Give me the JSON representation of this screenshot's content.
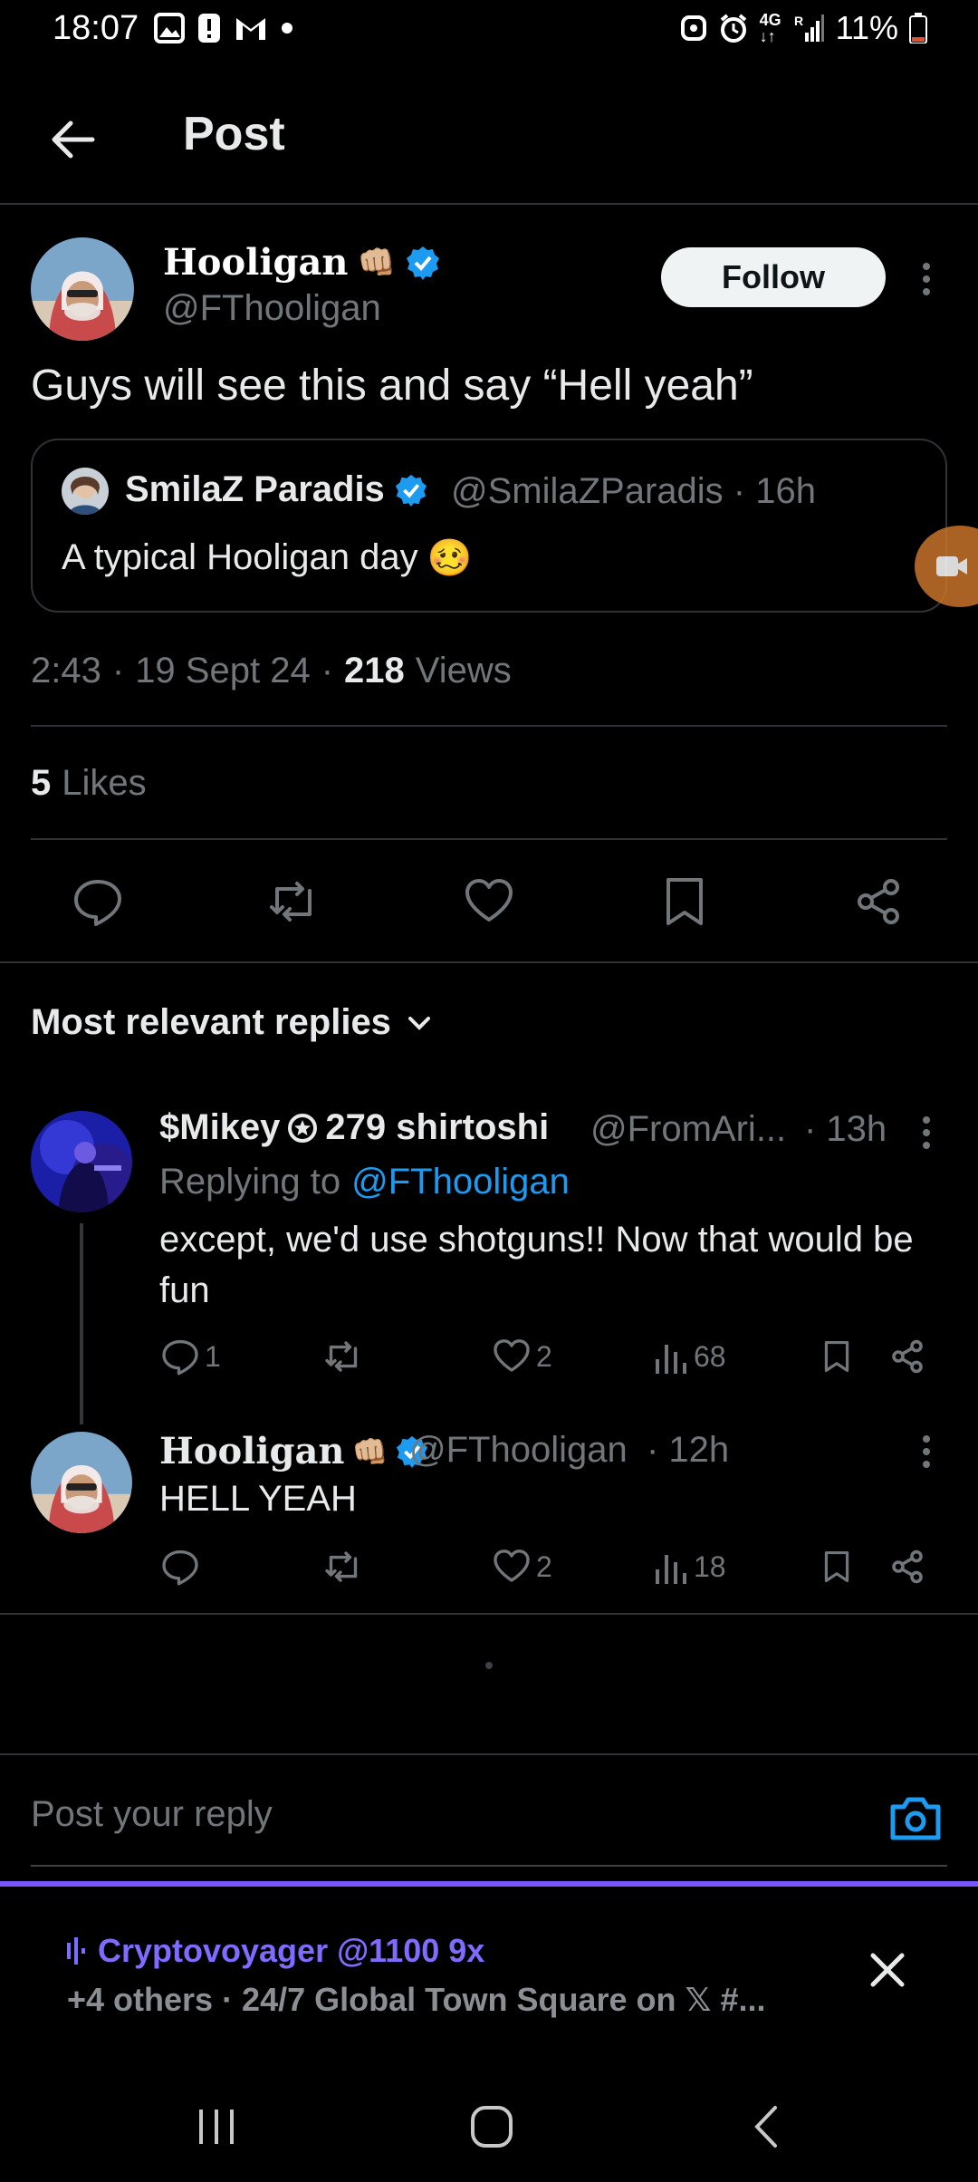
{
  "status_bar": {
    "time": "18:07",
    "network": "4G",
    "signal_label": "R",
    "battery": "11%"
  },
  "header": {
    "title": "Post"
  },
  "post": {
    "author_name": "Hooligan",
    "author_emoji": "👊🏼",
    "author_handle": "@FThooligan",
    "follow_label": "Follow",
    "text": "Guys will see this and say “Hell yeah”",
    "quote": {
      "name": "SmilaZ Paradis",
      "handle_time": "@SmilaZParadis · 16h",
      "text": "A typical Hooligan day",
      "emoji": "🥴"
    },
    "time": "2:43",
    "date": "19 Sept 24",
    "views_count": "218",
    "views_label": "Views",
    "likes_count": "5",
    "likes_label": "Likes"
  },
  "replies_sort_label": "Most relevant replies",
  "replies": [
    {
      "name": "$Mikey",
      "name_suffix": "279 shirtoshi",
      "handle": "@FromAri...",
      "time": "· 13h",
      "replying_prefix": "Replying to",
      "replying_handle": "@FThooligan",
      "text": "except, we'd use shotguns!! Now that would be fun",
      "replies_count": "1",
      "likes_count": "2",
      "views_count": "68"
    },
    {
      "name": "Hooligan",
      "emoji": "👊🏼",
      "handle": "@FThooligan",
      "time": "· 12h",
      "text": "HELL YEAH",
      "likes_count": "2",
      "views_count": "18"
    }
  ],
  "reply_box": {
    "placeholder": "Post your reply"
  },
  "space": {
    "title": "Cryptovoyager @1100 9x",
    "subtitle": "+4 others · 24/7 Global Town Square on 𝕏 #..."
  },
  "colors": {
    "accent": "#1d9bf0",
    "space_accent": "#7856ff",
    "muted": "#71767b"
  }
}
